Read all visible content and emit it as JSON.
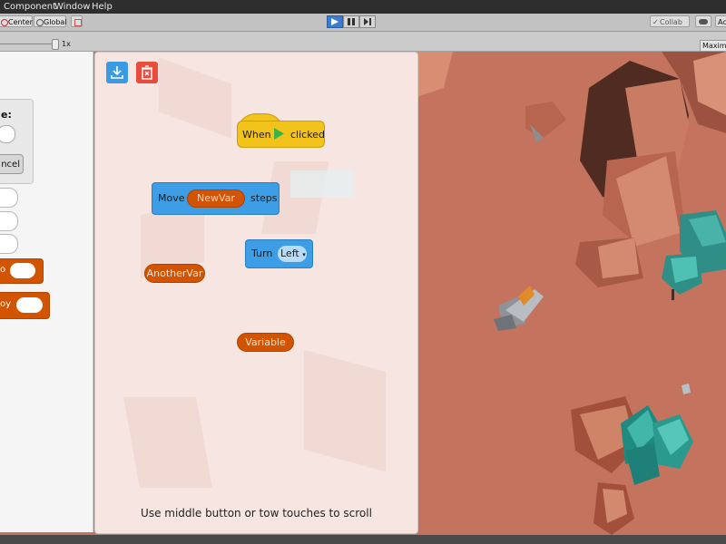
{
  "menu": {
    "items": [
      "Component",
      "Window",
      "Help"
    ]
  },
  "toolbar": {
    "center_label": "Center",
    "global_label": "Global",
    "collab_label": "Collab ▾",
    "account_label": "Ac"
  },
  "gameview": {
    "scale_label": "1x",
    "maximize_label": "Maximiz"
  },
  "left_panel": {
    "dialog_title": "e:",
    "cancel_label": "ncel",
    "block1_label": "o",
    "block2_label": "oy"
  },
  "blocks": {
    "when_label": "When",
    "clicked_label": "clicked",
    "move_label": "Move",
    "move_var": "NewVar",
    "steps_label": "steps",
    "turn_label": "Turn",
    "turn_value": "Left",
    "var_another": "AnotherVar",
    "var_variable": "Variable"
  },
  "hint": "Use middle button or tow touches to scroll",
  "colors": {
    "event_yellow": "#f2c31b",
    "motion_blue": "#3d9ee5",
    "variable_orange": "#d35400",
    "delete_red": "#e74c3c",
    "terrain": "#c4735e"
  }
}
